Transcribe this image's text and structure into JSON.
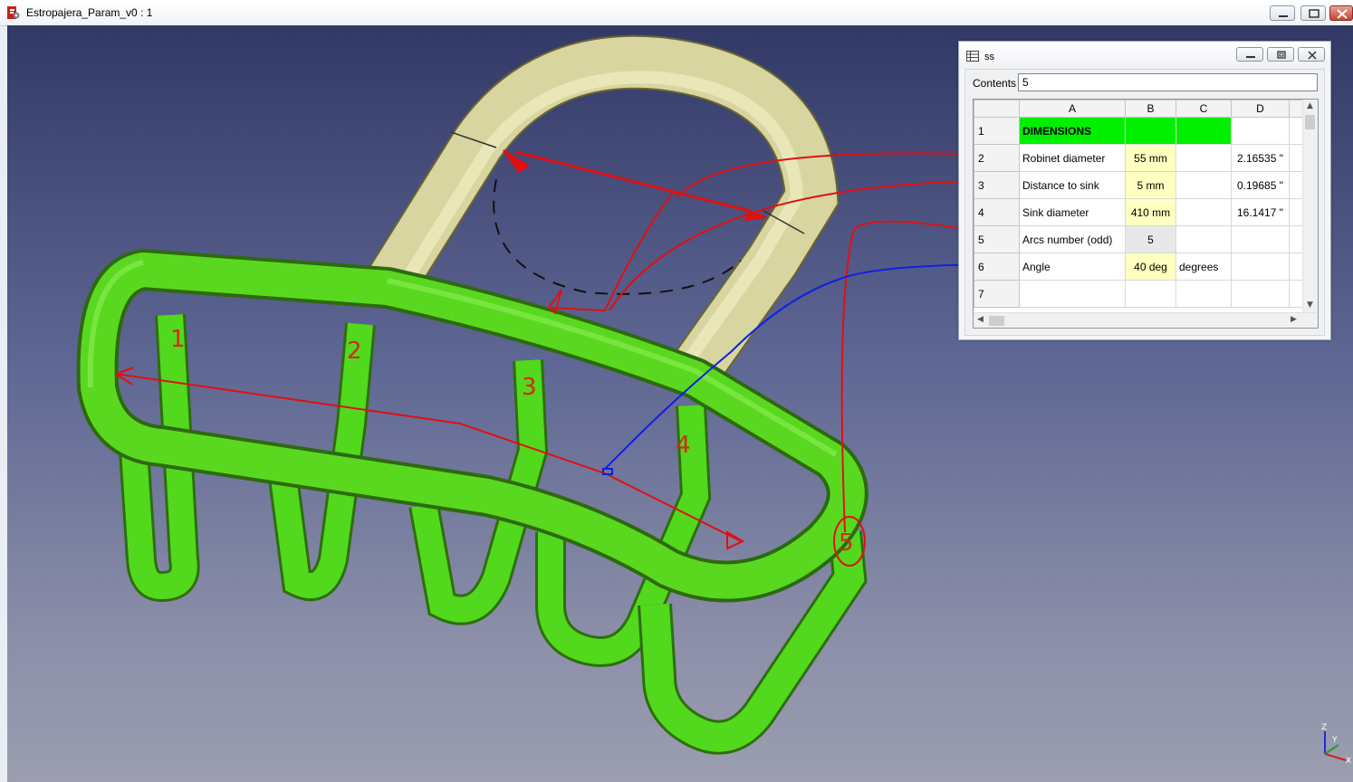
{
  "window": {
    "title": "Estropajera_Param_v0 : 1"
  },
  "spreadsheet": {
    "title": "ss",
    "contents_label": "Contents",
    "contents_value": "5",
    "columns": [
      "A",
      "B",
      "C",
      "D"
    ],
    "rows": [
      {
        "num": "1",
        "a": "DIMENSIONS",
        "b": "",
        "c": "",
        "d": ""
      },
      {
        "num": "2",
        "a": "Robinet diameter",
        "b": "55 mm",
        "c": "",
        "d": "2.16535 \""
      },
      {
        "num": "3",
        "a": "Distance to sink",
        "b": "5 mm",
        "c": "",
        "d": "0.19685 \""
      },
      {
        "num": "4",
        "a": "Sink diameter",
        "b": "410 mm",
        "c": "",
        "d": "16.1417 \""
      },
      {
        "num": "5",
        "a": "Arcs number (odd)",
        "b": "5",
        "c": "",
        "d": ""
      },
      {
        "num": "6",
        "a": "Angle",
        "b": "40 deg",
        "c": "degrees",
        "d": ""
      },
      {
        "num": "7",
        "a": "",
        "b": "",
        "c": "",
        "d": ""
      }
    ]
  },
  "annotations": {
    "arc_numbers": [
      "1",
      "2",
      "3",
      "4",
      "5"
    ]
  },
  "axis": {
    "labels": [
      "Z",
      "Y",
      "X"
    ]
  },
  "colors": {
    "green_part": "#4fd11c",
    "yellow_part": "#d6d39a",
    "annotation_red": "#e01010",
    "annotation_blue": "#1020e0",
    "dimensions_fill": "#00f000",
    "input_cell": "#ffffbf"
  }
}
